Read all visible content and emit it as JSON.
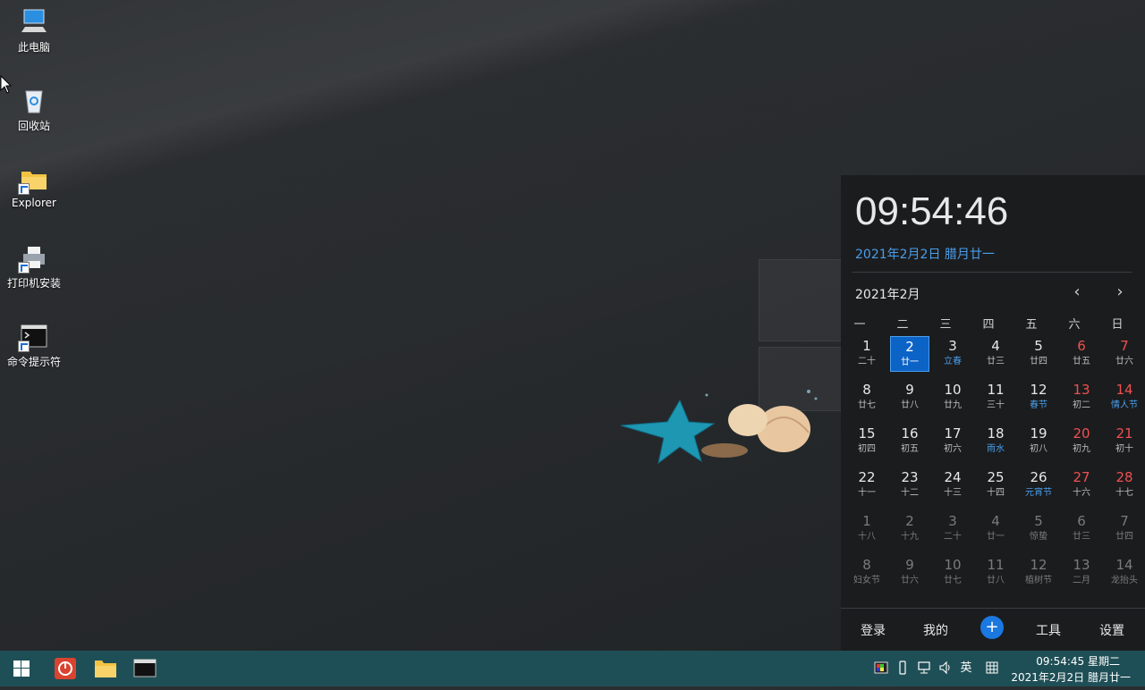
{
  "desktop": {
    "icons": [
      {
        "label": "此电脑",
        "icon": "computer-icon"
      },
      {
        "label": "回收站",
        "icon": "recycle-bin-icon"
      },
      {
        "label": "Explorer",
        "icon": "folder-icon"
      },
      {
        "label": "打印机安装",
        "icon": "printer-icon"
      },
      {
        "label": "命令提示符",
        "icon": "cmd-icon"
      }
    ]
  },
  "calendar": {
    "time": "09:54:46",
    "date_line": "2021年2月2日 腊月廿一",
    "month_label": "2021年2月",
    "prev_icon": "chevron-left-icon",
    "next_icon": "chevron-right-icon",
    "weekdays": [
      "一",
      "二",
      "三",
      "四",
      "五",
      "六",
      "日"
    ],
    "weeks": [
      [
        {
          "n": "1",
          "l": "二十"
        },
        {
          "n": "2",
          "l": "廿一",
          "today": true
        },
        {
          "n": "3",
          "l": "立春",
          "fest": true
        },
        {
          "n": "4",
          "l": "廿三"
        },
        {
          "n": "5",
          "l": "廿四"
        },
        {
          "n": "6",
          "l": "廿五",
          "we": true
        },
        {
          "n": "7",
          "l": "廿六",
          "we": true
        }
      ],
      [
        {
          "n": "8",
          "l": "廿七"
        },
        {
          "n": "9",
          "l": "廿八"
        },
        {
          "n": "10",
          "l": "廿九"
        },
        {
          "n": "11",
          "l": "三十"
        },
        {
          "n": "12",
          "l": "春节",
          "fest": true
        },
        {
          "n": "13",
          "l": "初二",
          "we": true
        },
        {
          "n": "14",
          "l": "情人节",
          "we": true,
          "fest": true
        }
      ],
      [
        {
          "n": "15",
          "l": "初四"
        },
        {
          "n": "16",
          "l": "初五"
        },
        {
          "n": "17",
          "l": "初六"
        },
        {
          "n": "18",
          "l": "雨水",
          "fest": true
        },
        {
          "n": "19",
          "l": "初八"
        },
        {
          "n": "20",
          "l": "初九",
          "we": true
        },
        {
          "n": "21",
          "l": "初十",
          "we": true
        }
      ],
      [
        {
          "n": "22",
          "l": "十一"
        },
        {
          "n": "23",
          "l": "十二"
        },
        {
          "n": "24",
          "l": "十三"
        },
        {
          "n": "25",
          "l": "十四"
        },
        {
          "n": "26",
          "l": "元宵节",
          "fest": true
        },
        {
          "n": "27",
          "l": "十六",
          "we": true
        },
        {
          "n": "28",
          "l": "十七",
          "we": true
        }
      ],
      [
        {
          "n": "1",
          "l": "十八",
          "dim": true
        },
        {
          "n": "2",
          "l": "十九",
          "dim": true
        },
        {
          "n": "3",
          "l": "二十",
          "dim": true
        },
        {
          "n": "4",
          "l": "廿一",
          "dim": true
        },
        {
          "n": "5",
          "l": "惊蛰",
          "dim": true
        },
        {
          "n": "6",
          "l": "廿三",
          "dim": true
        },
        {
          "n": "7",
          "l": "廿四",
          "dim": true
        }
      ],
      [
        {
          "n": "8",
          "l": "妇女节",
          "dim": true
        },
        {
          "n": "9",
          "l": "廿六",
          "dim": true
        },
        {
          "n": "10",
          "l": "廿七",
          "dim": true
        },
        {
          "n": "11",
          "l": "廿八",
          "dim": true
        },
        {
          "n": "12",
          "l": "植树节",
          "dim": true
        },
        {
          "n": "13",
          "l": "二月",
          "dim": true
        },
        {
          "n": "14",
          "l": "龙抬头",
          "dim": true
        }
      ]
    ],
    "footer": {
      "login": "登录",
      "mine": "我的",
      "plus": "+",
      "tools": "工具",
      "settings": "设置"
    }
  },
  "taskbar": {
    "ime_label": "英",
    "clock_time": "09:54:45 星期二",
    "clock_date": "2021年2月2日 腊月廿一"
  },
  "colors": {
    "accent": "#0c63c6",
    "festival": "#4a9eea",
    "weekend": "#f05050",
    "taskbar": "#1f4f56"
  }
}
